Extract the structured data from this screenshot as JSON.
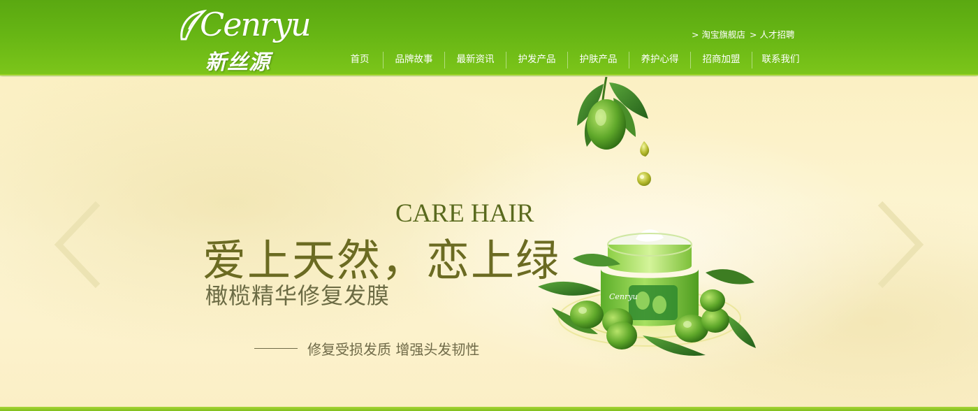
{
  "brand": {
    "logo_script": "Cenryu",
    "logo_cn": "新丝源"
  },
  "toplinks": [
    {
      "arrow": ">",
      "label": "淘宝旗舰店"
    },
    {
      "arrow": ">",
      "label": "人才招聘"
    }
  ],
  "nav": [
    {
      "label": "首页"
    },
    {
      "label": "品牌故事"
    },
    {
      "label": "最新资讯"
    },
    {
      "label": "护发产品"
    },
    {
      "label": "护肤产品"
    },
    {
      "label": "养护心得"
    },
    {
      "label": "招商加盟"
    },
    {
      "label": "联系我们"
    }
  ],
  "banner": {
    "care_hair": "CARE HAIR",
    "headline": "爱上天然，恋上绿",
    "subhead": "橄榄精华修复发膜",
    "tagline": "修复受损发质 增强头发韧性",
    "product_label": "Cenryu"
  },
  "colors": {
    "header_green": "#66b514",
    "banner_bg": "#fdf5d3",
    "headline": "#6b6b22",
    "care_hair": "#5a6a1e"
  }
}
